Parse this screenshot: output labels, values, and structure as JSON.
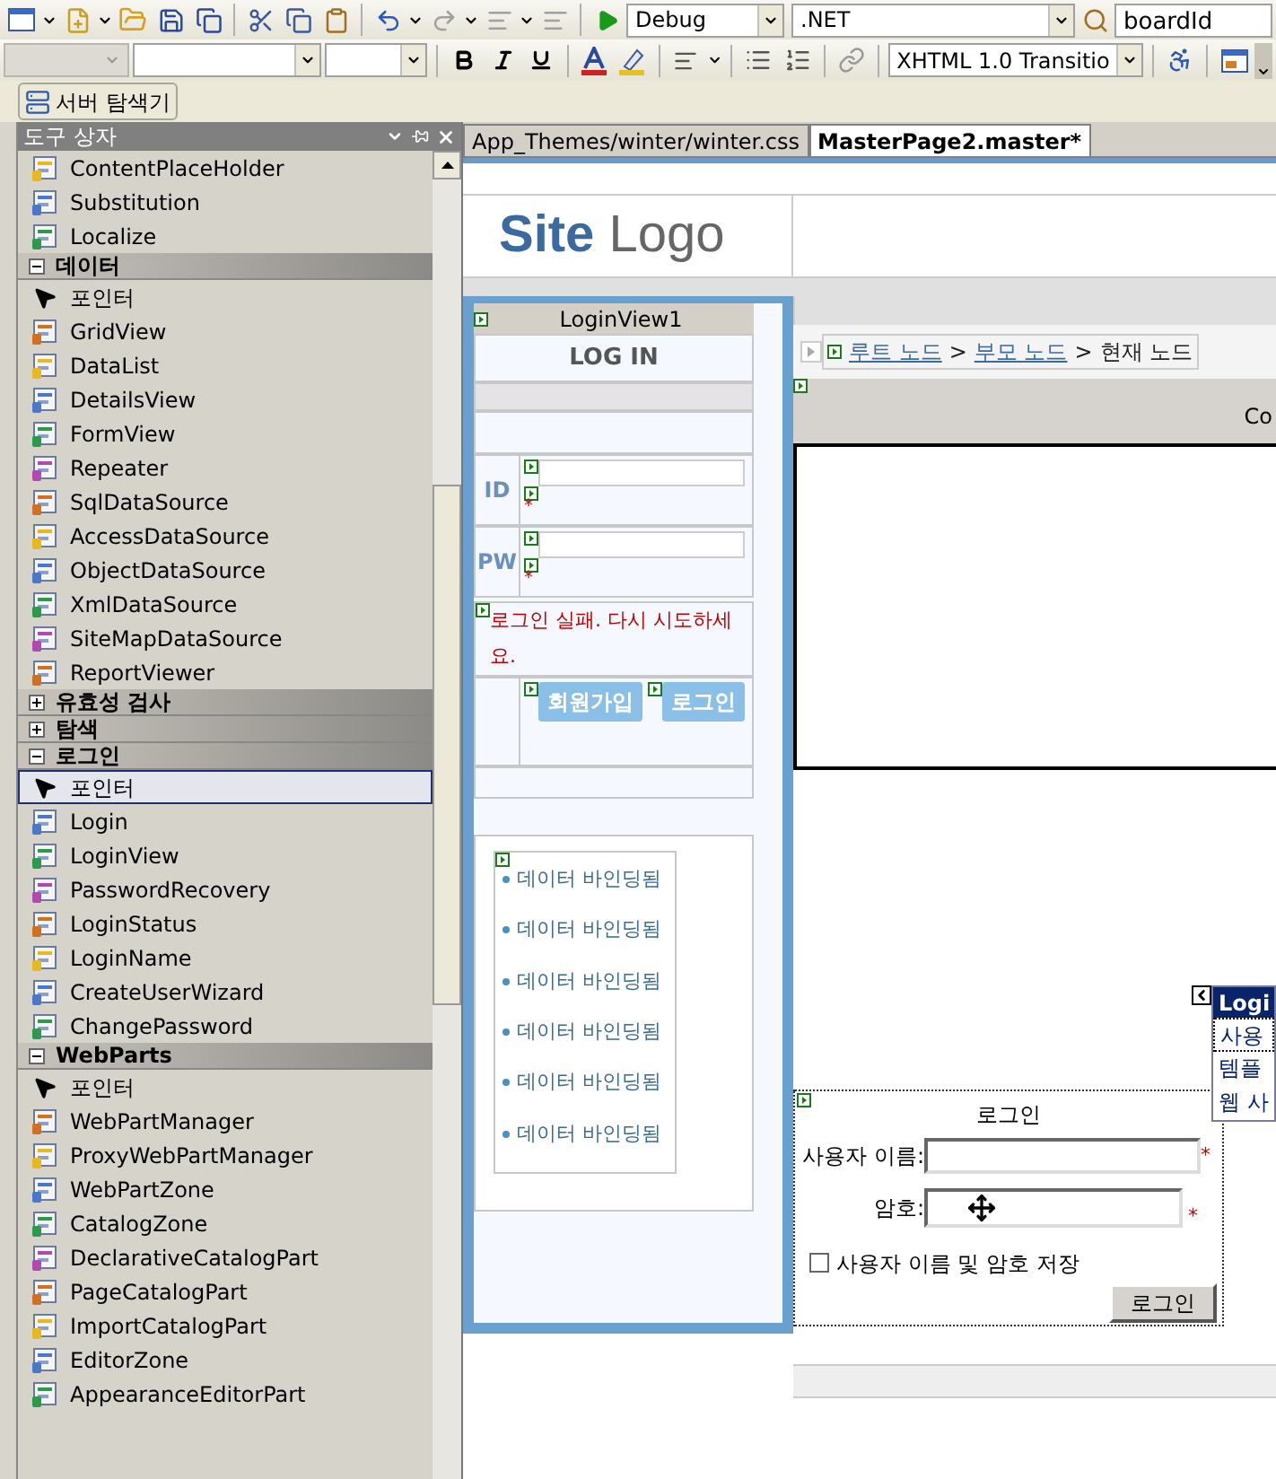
{
  "toolbar": {
    "configuration": "Debug",
    "platform": ".NET",
    "find": "boardId",
    "doctype": "XHTML 1.0 Transitio"
  },
  "server_explorer": {
    "label": "서버 탐색기"
  },
  "toolbox": {
    "title": "도구 상자",
    "top_items": [
      {
        "label": "ContentPlaceHolder",
        "kind": "control",
        "selected": false
      },
      {
        "label": "Substitution",
        "kind": "control",
        "selected": false
      },
      {
        "label": "Localize",
        "kind": "control",
        "selected": false
      }
    ],
    "sections": [
      {
        "label": "데이터",
        "expanded": true,
        "items": [
          {
            "label": "포인터",
            "kind": "pointer",
            "selected": false
          },
          {
            "label": "GridView",
            "kind": "control",
            "selected": false
          },
          {
            "label": "DataList",
            "kind": "control",
            "selected": false
          },
          {
            "label": "DetailsView",
            "kind": "control",
            "selected": false
          },
          {
            "label": "FormView",
            "kind": "control",
            "selected": false
          },
          {
            "label": "Repeater",
            "kind": "control",
            "selected": false
          },
          {
            "label": "SqlDataSource",
            "kind": "control",
            "selected": false
          },
          {
            "label": "AccessDataSource",
            "kind": "control",
            "selected": false
          },
          {
            "label": "ObjectDataSource",
            "kind": "control",
            "selected": false
          },
          {
            "label": "XmlDataSource",
            "kind": "control",
            "selected": false
          },
          {
            "label": "SiteMapDataSource",
            "kind": "control",
            "selected": false
          },
          {
            "label": "ReportViewer",
            "kind": "control",
            "selected": false
          }
        ]
      },
      {
        "label": "유효성 검사",
        "expanded": false
      },
      {
        "label": "탐색",
        "expanded": false
      },
      {
        "label": "로그인",
        "expanded": true,
        "items": [
          {
            "label": "포인터",
            "kind": "pointer",
            "selected": true
          },
          {
            "label": "Login",
            "kind": "control",
            "selected": false
          },
          {
            "label": "LoginView",
            "kind": "control",
            "selected": false
          },
          {
            "label": "PasswordRecovery",
            "kind": "control",
            "selected": false
          },
          {
            "label": "LoginStatus",
            "kind": "control",
            "selected": false
          },
          {
            "label": "LoginName",
            "kind": "control",
            "selected": false
          },
          {
            "label": "CreateUserWizard",
            "kind": "control",
            "selected": false
          },
          {
            "label": "ChangePassword",
            "kind": "control",
            "selected": false
          }
        ]
      },
      {
        "label": "WebParts",
        "expanded": true,
        "items": [
          {
            "label": "포인터",
            "kind": "pointer",
            "selected": false
          },
          {
            "label": "WebPartManager",
            "kind": "control",
            "selected": false
          },
          {
            "label": "ProxyWebPartManager",
            "kind": "control",
            "selected": false
          },
          {
            "label": "WebPartZone",
            "kind": "control",
            "selected": false
          },
          {
            "label": "CatalogZone",
            "kind": "control",
            "selected": false
          },
          {
            "label": "DeclarativeCatalogPart",
            "kind": "control",
            "selected": false
          },
          {
            "label": "PageCatalogPart",
            "kind": "control",
            "selected": false
          },
          {
            "label": "ImportCatalogPart",
            "kind": "control",
            "selected": false
          },
          {
            "label": "EditorZone",
            "kind": "control",
            "selected": false
          },
          {
            "label": "AppearanceEditorPart",
            "kind": "control",
            "selected": false
          }
        ]
      }
    ]
  },
  "tabs": [
    {
      "label": "App_Themes/winter/winter.css",
      "selected": false
    },
    {
      "label": "MasterPage2.master*",
      "selected": true
    }
  ],
  "design": {
    "logo": {
      "bold": "Site",
      "light": "Logo"
    },
    "login_view": {
      "title": "LoginView1",
      "heading": "LOG IN",
      "id_label": "ID",
      "id_validator": "*",
      "pw_label": "PW",
      "pw_validator": "*",
      "error": "로그인 실패. 다시 시도하세요.",
      "buttons": [
        "회원가입",
        "로그인"
      ]
    },
    "data_list": [
      "데이터 바인딩됨",
      "데이터 바인딩됨",
      "데이터 바인딩됨",
      "데이터 바인딩됨",
      "데이터 바인딩됨",
      "데이터 바인딩됨"
    ],
    "breadcrumb": [
      {
        "text": "루트 노드",
        "kind": "link"
      },
      {
        "text": ">",
        "kind": "separator"
      },
      {
        "text": "부모 노드",
        "kind": "link"
      },
      {
        "text": ">",
        "kind": "separator"
      },
      {
        "text": "현재 노드",
        "kind": "current"
      }
    ],
    "content_header": "Co",
    "login": {
      "title": "로그인",
      "username_label": "사용자 이름:",
      "username_validator": "*",
      "password_label": "암호:",
      "password_validator": "*",
      "remember": {
        "label": "사용자 이름 및 암호 저장",
        "checked": false
      },
      "button": "로그인"
    },
    "smart_tag": {
      "title": "Logi",
      "items": [
        "사용",
        "템플",
        "웹 사"
      ]
    }
  }
}
